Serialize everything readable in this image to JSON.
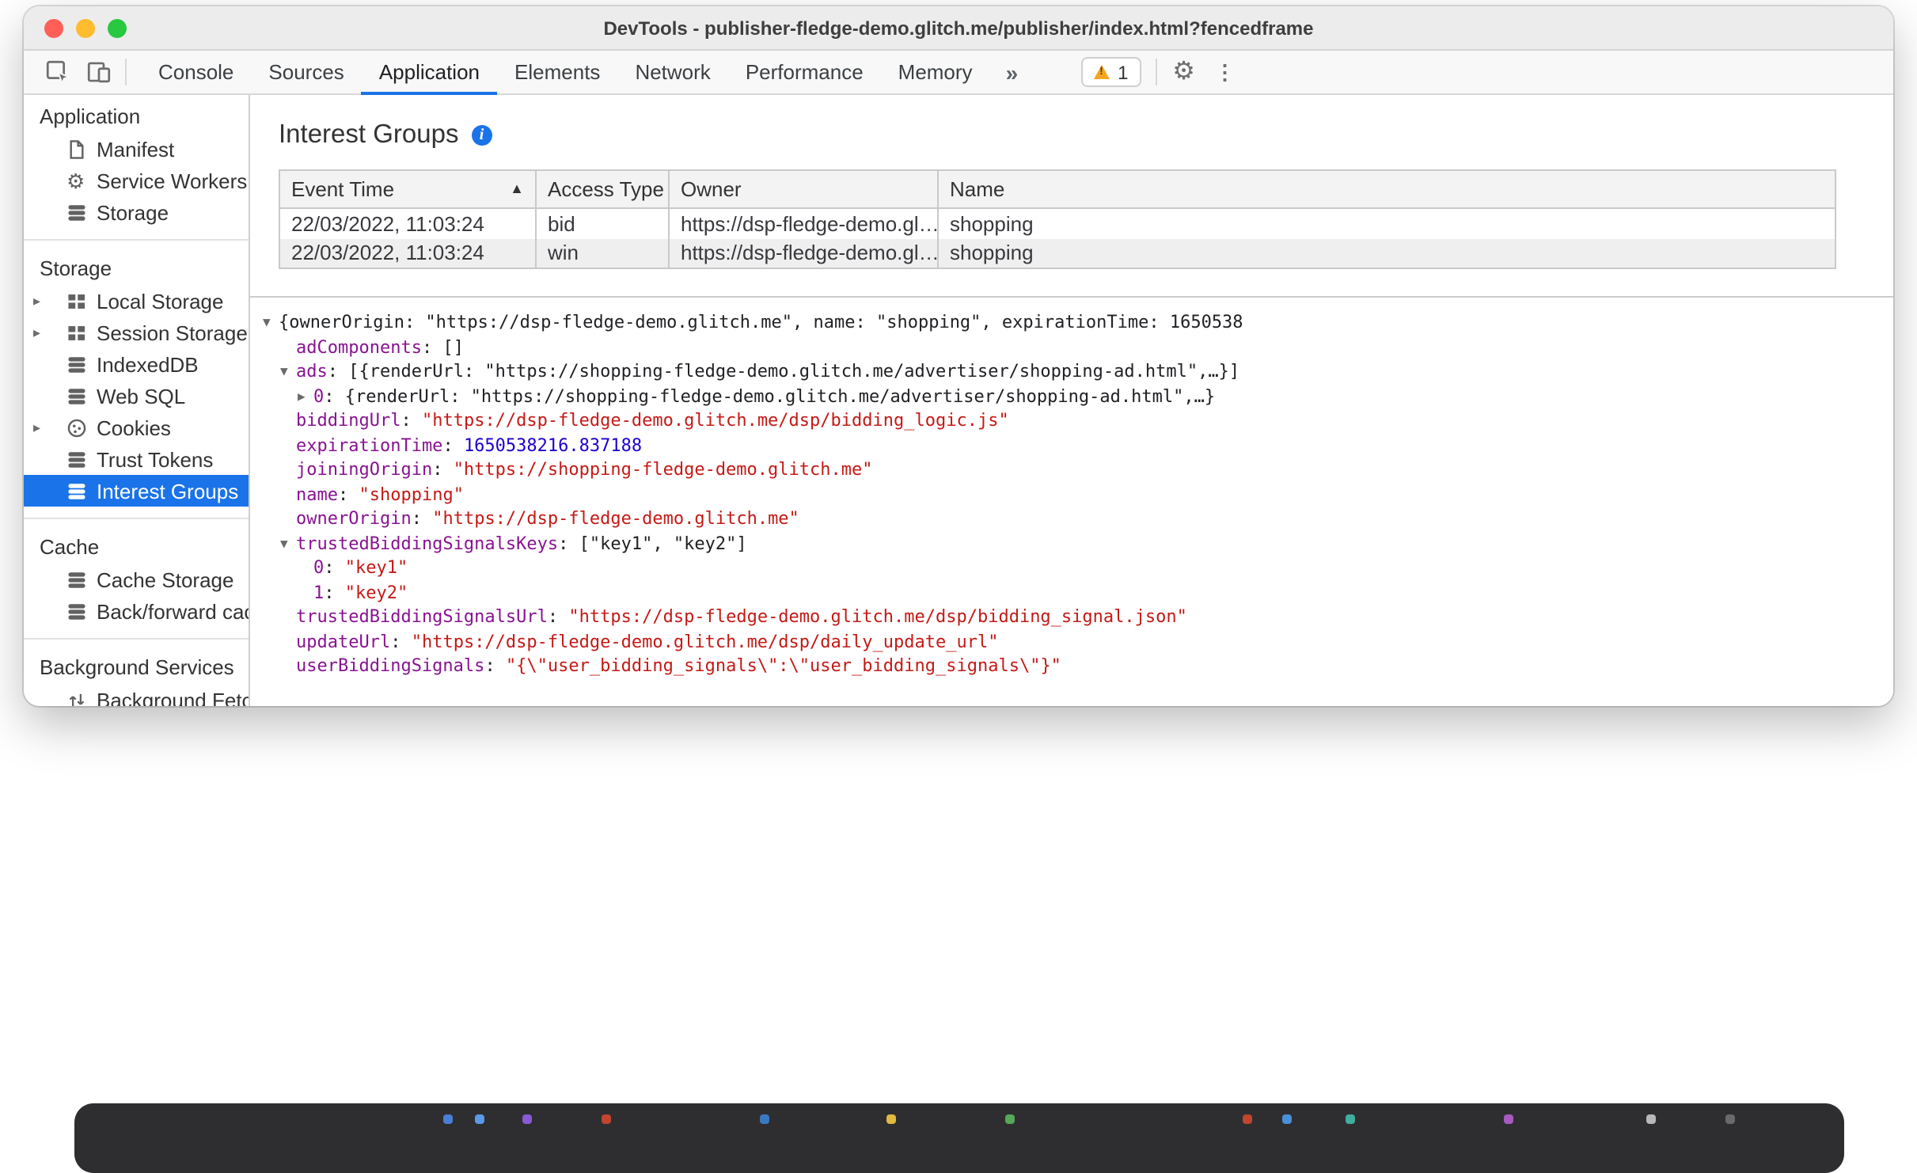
{
  "colors": {
    "accent": "#1a73e8",
    "json_key": "#881391",
    "json_string": "#c41a16",
    "json_number": "#1c00cf"
  },
  "window": {
    "title": "DevTools - publisher-fledge-demo.glitch.me/publisher/index.html?fencedframe",
    "traffic_lights": [
      "#ff5f57",
      "#febc2e",
      "#28c840"
    ]
  },
  "toolbar": {
    "left_icons": [
      "inspect-icon",
      "device-toolbar-icon"
    ],
    "tabs": [
      {
        "label": "Console",
        "active": false
      },
      {
        "label": "Sources",
        "active": false
      },
      {
        "label": "Application",
        "active": true
      },
      {
        "label": "Elements",
        "active": false
      },
      {
        "label": "Network",
        "active": false
      },
      {
        "label": "Performance",
        "active": false
      },
      {
        "label": "Memory",
        "active": false
      }
    ],
    "more_tabs_label": "»",
    "issues_count": "1",
    "right_icons": [
      "warning-icon",
      "gear-icon",
      "kebab-menu-icon"
    ]
  },
  "sidebar": {
    "expander_icon": "▸",
    "sections": [
      {
        "header": "Application",
        "items": [
          {
            "label": "Manifest",
            "icon": "document"
          },
          {
            "label": "Service Workers",
            "icon": "gear"
          },
          {
            "label": "Storage",
            "icon": "database"
          }
        ]
      },
      {
        "header": "Storage",
        "items": [
          {
            "label": "Local Storage",
            "icon": "grid",
            "expander": true
          },
          {
            "label": "Session Storage",
            "icon": "grid",
            "expander": true
          },
          {
            "label": "IndexedDB",
            "icon": "database"
          },
          {
            "label": "Web SQL",
            "icon": "database"
          },
          {
            "label": "Cookies",
            "icon": "cookie",
            "expander": true
          },
          {
            "label": "Trust Tokens",
            "icon": "database"
          },
          {
            "label": "Interest Groups",
            "icon": "database",
            "selected": true
          }
        ]
      },
      {
        "header": "Cache",
        "items": [
          {
            "label": "Cache Storage",
            "icon": "database"
          },
          {
            "label": "Back/forward cache",
            "icon": "database"
          }
        ]
      },
      {
        "header": "Background Services",
        "items": [
          {
            "label": "Background Fetch",
            "icon": "updown"
          }
        ]
      }
    ]
  },
  "main": {
    "title": "Interest Groups",
    "info_icon": "info-icon",
    "table": {
      "columns": [
        "Event Time",
        "Access Type",
        "Owner",
        "Name"
      ],
      "sort_column": "Event Time",
      "sort_indicator": "▲",
      "rows": [
        [
          "22/03/2022, 11:03:24",
          "bid",
          "https://dsp-fledge-demo.gl…",
          "shopping"
        ],
        [
          "22/03/2022, 11:03:24",
          "win",
          "https://dsp-fledge-demo.gl…",
          "shopping"
        ]
      ]
    },
    "tree_icons": {
      "down": "▼",
      "right": "▶"
    },
    "tree": [
      {
        "indent": 0,
        "arrow": "down",
        "segments": [
          {
            "t": "plain",
            "x": "{ownerOrigin: \"https://dsp-fledge-demo.glitch.me\", name: \"shopping\", expirationTime: 1650538"
          }
        ]
      },
      {
        "indent": 1,
        "arrow": null,
        "segments": [
          {
            "t": "key",
            "x": "adComponents"
          },
          {
            "t": "plain",
            "x": ": []"
          }
        ]
      },
      {
        "indent": 1,
        "arrow": "down",
        "segments": [
          {
            "t": "key",
            "x": "ads"
          },
          {
            "t": "plain",
            "x": ": [{renderUrl: \"https://shopping-fledge-demo.glitch.me/advertiser/shopping-ad.html\",…}]"
          }
        ]
      },
      {
        "indent": 2,
        "arrow": "right",
        "segments": [
          {
            "t": "key",
            "x": "0"
          },
          {
            "t": "plain",
            "x": ": {renderUrl: \"https://shopping-fledge-demo.glitch.me/advertiser/shopping-ad.html\",…}"
          }
        ]
      },
      {
        "indent": 1,
        "arrow": null,
        "segments": [
          {
            "t": "key",
            "x": "biddingUrl"
          },
          {
            "t": "plain",
            "x": ": "
          },
          {
            "t": "str",
            "x": "\"https://dsp-fledge-demo.glitch.me/dsp/bidding_logic.js\""
          }
        ]
      },
      {
        "indent": 1,
        "arrow": null,
        "segments": [
          {
            "t": "key",
            "x": "expirationTime"
          },
          {
            "t": "plain",
            "x": ": "
          },
          {
            "t": "num",
            "x": "1650538216.837188"
          }
        ]
      },
      {
        "indent": 1,
        "arrow": null,
        "segments": [
          {
            "t": "key",
            "x": "joiningOrigin"
          },
          {
            "t": "plain",
            "x": ": "
          },
          {
            "t": "str",
            "x": "\"https://shopping-fledge-demo.glitch.me\""
          }
        ]
      },
      {
        "indent": 1,
        "arrow": null,
        "segments": [
          {
            "t": "key",
            "x": "name"
          },
          {
            "t": "plain",
            "x": ": "
          },
          {
            "t": "str",
            "x": "\"shopping\""
          }
        ]
      },
      {
        "indent": 1,
        "arrow": null,
        "segments": [
          {
            "t": "key",
            "x": "ownerOrigin"
          },
          {
            "t": "plain",
            "x": ": "
          },
          {
            "t": "str",
            "x": "\"https://dsp-fledge-demo.glitch.me\""
          }
        ]
      },
      {
        "indent": 1,
        "arrow": "down",
        "segments": [
          {
            "t": "key",
            "x": "trustedBiddingSignalsKeys"
          },
          {
            "t": "plain",
            "x": ": [\"key1\", \"key2\"]"
          }
        ]
      },
      {
        "indent": 2,
        "arrow": null,
        "segments": [
          {
            "t": "key",
            "x": "0"
          },
          {
            "t": "plain",
            "x": ": "
          },
          {
            "t": "str",
            "x": "\"key1\""
          }
        ]
      },
      {
        "indent": 2,
        "arrow": null,
        "segments": [
          {
            "t": "key",
            "x": "1"
          },
          {
            "t": "plain",
            "x": ": "
          },
          {
            "t": "str",
            "x": "\"key2\""
          }
        ]
      },
      {
        "indent": 1,
        "arrow": null,
        "segments": [
          {
            "t": "key",
            "x": "trustedBiddingSignalsUrl"
          },
          {
            "t": "plain",
            "x": ": "
          },
          {
            "t": "str",
            "x": "\"https://dsp-fledge-demo.glitch.me/dsp/bidding_signal.json\""
          }
        ]
      },
      {
        "indent": 1,
        "arrow": null,
        "segments": [
          {
            "t": "key",
            "x": "updateUrl"
          },
          {
            "t": "plain",
            "x": ": "
          },
          {
            "t": "str",
            "x": "\"https://dsp-fledge-demo.glitch.me/dsp/daily_update_url\""
          }
        ]
      },
      {
        "indent": 1,
        "arrow": null,
        "segments": [
          {
            "t": "key",
            "x": "userBiddingSignals"
          },
          {
            "t": "plain",
            "x": ": "
          },
          {
            "t": "str",
            "x": "\"{\\\"user_bidding_signals\\\":\\\"user_bidding_signals\\\"}\""
          }
        ]
      }
    ]
  },
  "dock": {
    "app_colors": [
      "#4a7fd6",
      "#5a9ae6",
      "#8a5ad6",
      "#c2452e",
      "#3b78c2",
      "#e0b93e",
      "#55a858",
      "#c2452e",
      "#4a90d9",
      "#3fae9e",
      "#a85ac2",
      "#b8b8b8",
      "#6a6a6a"
    ]
  }
}
